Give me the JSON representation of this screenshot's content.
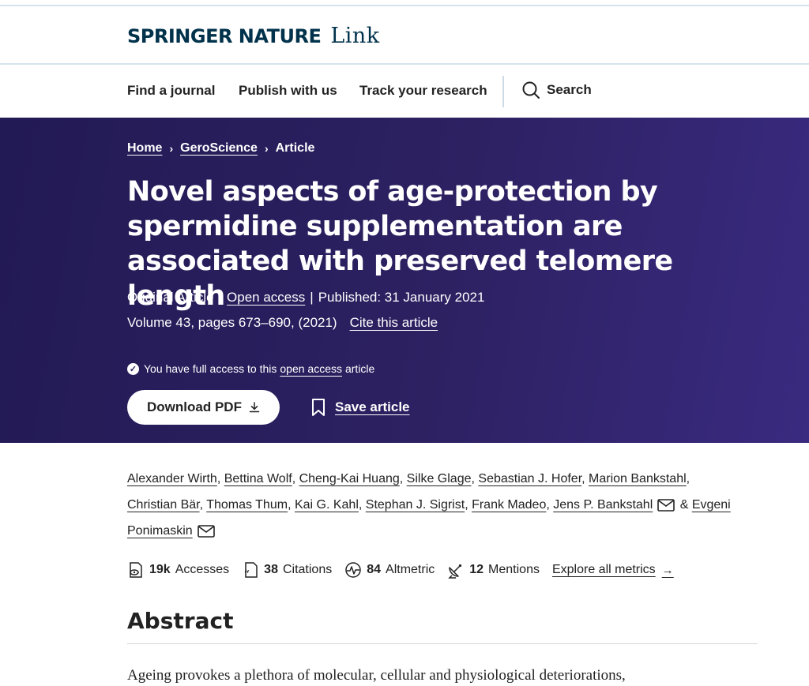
{
  "brand": {
    "main": "SPRINGER NATURE",
    "sub": "Link"
  },
  "nav": {
    "items": [
      "Find a journal",
      "Publish with us",
      "Track your research"
    ],
    "search_label": "Search"
  },
  "breadcrumb": {
    "items": [
      "Home",
      "GeroScience",
      "Article"
    ],
    "separator": "›"
  },
  "article": {
    "title": "Novel aspects of age-protection by spermidine supplementation are associated with preserved telomere length",
    "type": "Original Article",
    "open_access": "Open access",
    "published": "Published: 31 January 2021",
    "volume": "Volume 43, pages 673–690, (2021)",
    "cite": "Cite this article"
  },
  "access": {
    "prefix": "You have full access to this",
    "link": "open access",
    "suffix": "article"
  },
  "actions": {
    "download": "Download PDF",
    "save": "Save article"
  },
  "authors": [
    "Alexander Wirth",
    "Bettina Wolf",
    "Cheng-Kai Huang",
    "Silke Glage",
    "Sebastian J. Hofer",
    "Marion Bankstahl",
    "Christian Bär",
    "Thomas Thum",
    "Kai G. Kahl",
    "Stephan J. Sigrist",
    "Frank Madeo",
    "Jens P. Bankstahl",
    "Evgeni Ponimaskin"
  ],
  "metrics": {
    "accesses": {
      "value": "19k",
      "label": "Accesses"
    },
    "citations": {
      "value": "38",
      "label": "Citations"
    },
    "altmetric": {
      "value": "84",
      "label": "Altmetric"
    },
    "mentions": {
      "value": "12",
      "label": "Mentions"
    },
    "explore": "Explore all metrics",
    "explore_arrow": "→"
  },
  "abstract": {
    "heading": "Abstract",
    "text": "Ageing provokes a plethora of molecular, cellular and physiological deteriorations,"
  },
  "colors": {
    "hero": "#2d2162",
    "brand": "#01324b"
  }
}
